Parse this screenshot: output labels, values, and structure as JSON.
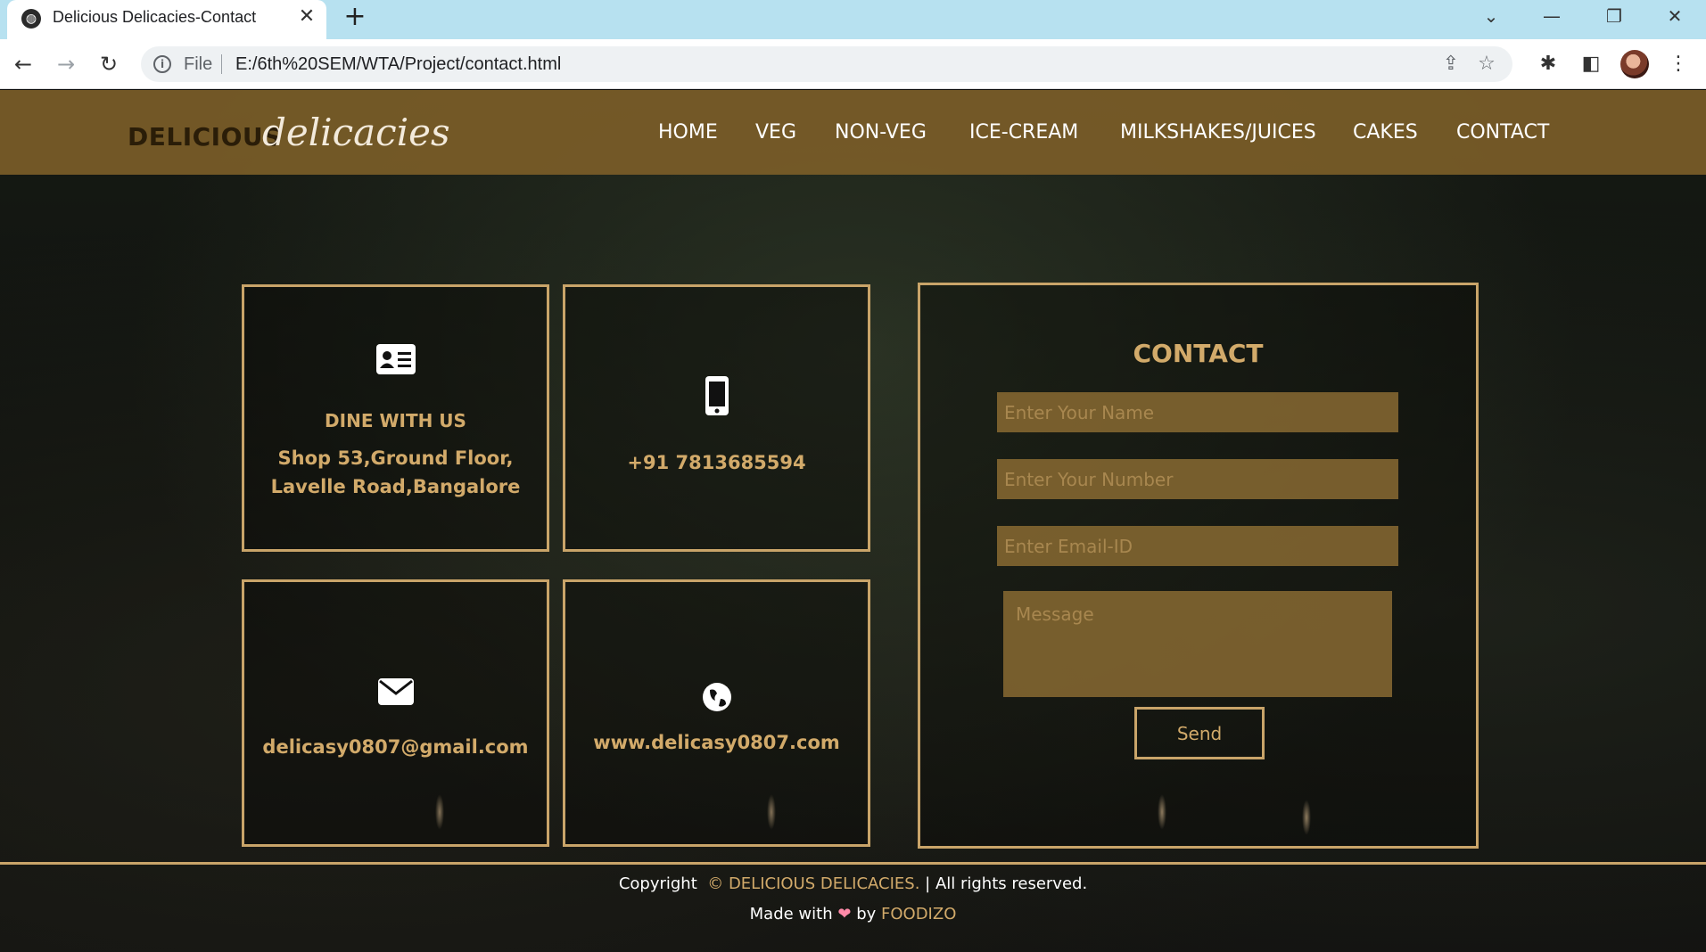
{
  "browser": {
    "tab_title": "Delicious Delicacies-Contact",
    "file_label": "File",
    "url": "E:/6th%20SEM/WTA/Project/contact.html"
  },
  "site": {
    "logo_main": "DELICIOUS",
    "logo_script": "delicacies",
    "nav": [
      "HOME",
      "VEG",
      "NON-VEG",
      "ICE-CREAM",
      "MILKSHAKES/JUICES",
      "CAKES",
      "CONTACT"
    ]
  },
  "cards": {
    "dine_title": "DINE WITH US",
    "address_line1": "Shop 53,Ground Floor,",
    "address_line2": "Lavelle Road,Bangalore",
    "phone": "+91 7813685594",
    "email": "delicasy0807@gmail.com",
    "website": "www.delicasy0807.com"
  },
  "form": {
    "title": "CONTACT",
    "name_placeholder": "Enter Your Name",
    "number_placeholder": "Enter Your Number",
    "email_placeholder": "Enter Email-ID",
    "message_placeholder": "Message",
    "send_label": "Send"
  },
  "footer": {
    "copyright_prefix": "Copyright",
    "copyright_brand": "© DELICIOUS DELICACIES.",
    "copyright_suffix": "| All rights reserved.",
    "made_with": "Made with",
    "by": "by",
    "author": "FOODIZO"
  },
  "colors": {
    "accent_gold": "#c9a469",
    "header_brown": "#7a5c28",
    "tabbar_blue": "#b7e1f0"
  },
  "icons": [
    "globe-icon",
    "close-icon",
    "plus-icon",
    "back-icon",
    "forward-icon",
    "reload-icon",
    "info-icon",
    "share-icon",
    "star-icon",
    "puzzle-icon",
    "sidepanel-icon",
    "menu-icon",
    "id-card-icon",
    "mobile-phone-icon",
    "envelope-icon",
    "globe-icon",
    "heart-icon"
  ]
}
